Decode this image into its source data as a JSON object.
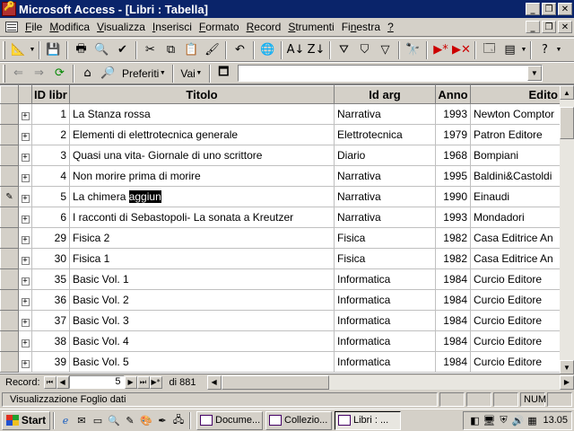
{
  "window": {
    "title": "Microsoft Access - [Libri : Tabella]",
    "minimize_icon": "minimize-icon",
    "restore_icon": "restore-icon",
    "close_icon": "close-icon"
  },
  "menu": {
    "items": [
      {
        "accel": "F",
        "rest": "ile"
      },
      {
        "accel": "M",
        "rest": "odifica"
      },
      {
        "accel": "V",
        "rest": "isualizza"
      },
      {
        "accel": "I",
        "rest": "nserisci"
      },
      {
        "accel": "F",
        "rest": "ormato"
      },
      {
        "accel": "R",
        "rest": "ecord"
      },
      {
        "accel": "S",
        "rest": "trumenti"
      },
      {
        "pre": "Fi",
        "accel": "n",
        "rest": "estra"
      },
      {
        "accel": "?",
        "rest": ""
      }
    ]
  },
  "web_toolbar": {
    "favorites_label": "Preferiti",
    "go_label": "Vai",
    "address_value": ""
  },
  "table": {
    "columns": [
      "ID libr",
      "Titolo",
      "Id arg",
      "Anno",
      "Edito"
    ],
    "current_row_indicator": "✎",
    "rows": [
      {
        "id": "1",
        "title": "La Stanza rossa",
        "arg": "Narrativa",
        "year": "1993",
        "publisher": "Newton Comptor"
      },
      {
        "id": "2",
        "title": "Elementi di elettrotecnica generale",
        "arg": "Elettrotecnica",
        "year": "1979",
        "publisher": "Patron Editore"
      },
      {
        "id": "3",
        "title": "Quasi una vita- Giornale di uno scrittore",
        "arg": "Diario",
        "year": "1968",
        "publisher": "Bompiani"
      },
      {
        "id": "4",
        "title": "Non morire prima di morire",
        "arg": "Narrativa",
        "year": "1995",
        "publisher": "Baldini&Castoldi"
      },
      {
        "id": "5",
        "title_plain": "La chimera ",
        "title_selected": "aggiun",
        "arg": "Narrativa",
        "year": "1990",
        "publisher": "Einaudi",
        "editing": true
      },
      {
        "id": "6",
        "title": "I racconti di Sebastopoli- La sonata a Kreutzer",
        "arg": "Narrativa",
        "year": "1993",
        "publisher": "Mondadori"
      },
      {
        "id": "29",
        "title": "Fisica 2",
        "arg": "Fisica",
        "year": "1982",
        "publisher": "Casa Editrice An"
      },
      {
        "id": "30",
        "title": "Fisica 1",
        "arg": "Fisica",
        "year": "1982",
        "publisher": "Casa Editrice An"
      },
      {
        "id": "35",
        "title": "Basic Vol. 1",
        "arg": "Informatica",
        "year": "1984",
        "publisher": "Curcio Editore"
      },
      {
        "id": "36",
        "title": "Basic Vol. 2",
        "arg": "Informatica",
        "year": "1984",
        "publisher": "Curcio Editore"
      },
      {
        "id": "37",
        "title": "Basic Vol. 3",
        "arg": "Informatica",
        "year": "1984",
        "publisher": "Curcio Editore"
      },
      {
        "id": "38",
        "title": "Basic Vol. 4",
        "arg": "Informatica",
        "year": "1984",
        "publisher": "Curcio Editore"
      },
      {
        "id": "39",
        "title": "Basic Vol. 5",
        "arg": "Informatica",
        "year": "1984",
        "publisher": "Curcio Editore"
      }
    ]
  },
  "record_nav": {
    "label": "Record:",
    "current": "5",
    "of_text": "di 881"
  },
  "status": {
    "message": "Visualizzazione Foglio dati",
    "num_indicator": "NUM"
  },
  "taskbar": {
    "start_label": "Start",
    "tasks": [
      {
        "label": "Docume...",
        "active": false
      },
      {
        "label": "Collezio...",
        "active": false
      },
      {
        "label": "Libri : ...",
        "active": true
      }
    ],
    "clock": "13.05"
  },
  "colors": {
    "titlebar": "#0a246a",
    "face": "#d4d0c8",
    "selection": "#000000"
  }
}
